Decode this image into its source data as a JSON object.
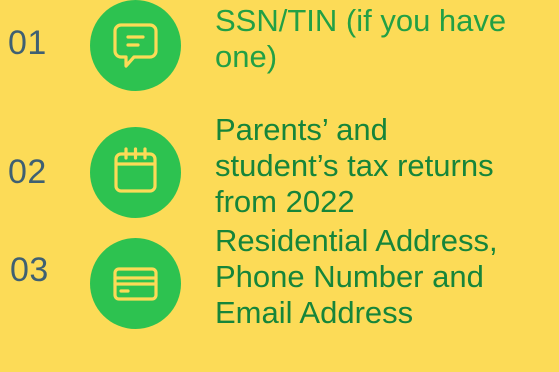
{
  "accent_color": "#2DC250",
  "background_color": "#FCDB57",
  "number_color": "#3F6072",
  "items": [
    {
      "number": "01",
      "icon": "chat-bubble-icon",
      "lines": [
        "SSN/TIN (if you have",
        "one)"
      ]
    },
    {
      "number": "02",
      "icon": "calendar-icon",
      "lines": [
        "Parents’ and",
        "student’s tax returns",
        "from 2022"
      ]
    },
    {
      "number": "03",
      "icon": "credit-card-icon",
      "lines": [
        "Residential Address,",
        "Phone Number and",
        "Email Address"
      ]
    }
  ]
}
